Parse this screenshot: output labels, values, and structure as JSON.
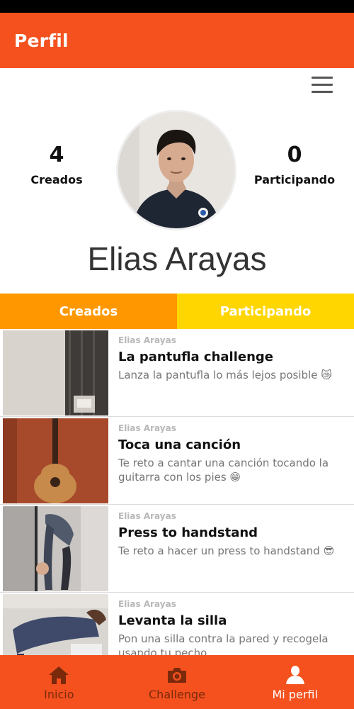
{
  "app_bar": {
    "title": "Perfil"
  },
  "stats": {
    "created_count": "4",
    "created_label": "Creados",
    "participating_count": "0",
    "participating_label": "Participando"
  },
  "profile": {
    "name": "Elias Arayas"
  },
  "tabs": [
    {
      "label": "Creados",
      "color": "#ff9800"
    },
    {
      "label": "Participando",
      "color": "#ffd600"
    }
  ],
  "challenges": [
    {
      "author": "Elias Arayas",
      "title": "La pantufla challenge",
      "description": "Lanza la pantufla lo más lejos posible 😿"
    },
    {
      "author": "Elias Arayas",
      "title": "Toca una canción",
      "description": "Te reto a cantar una canción tocando la guitarra con los pies 😁"
    },
    {
      "author": "Elias Arayas",
      "title": "Press to handstand",
      "description": "Te reto a hacer un press to handstand 😎"
    },
    {
      "author": "Elias Arayas",
      "title": "Levanta la silla",
      "description": "Pon una silla contra la pared y recogela usando tu pecho"
    }
  ],
  "bottom_nav": [
    {
      "label": "Inicio",
      "icon": "home-icon"
    },
    {
      "label": "Challenge",
      "icon": "camera-icon"
    },
    {
      "label": "Mi perfil",
      "icon": "person-icon",
      "active": true
    }
  ],
  "colors": {
    "primary": "#f4511e",
    "tab_created": "#ff9800",
    "tab_participating": "#ffd600"
  }
}
